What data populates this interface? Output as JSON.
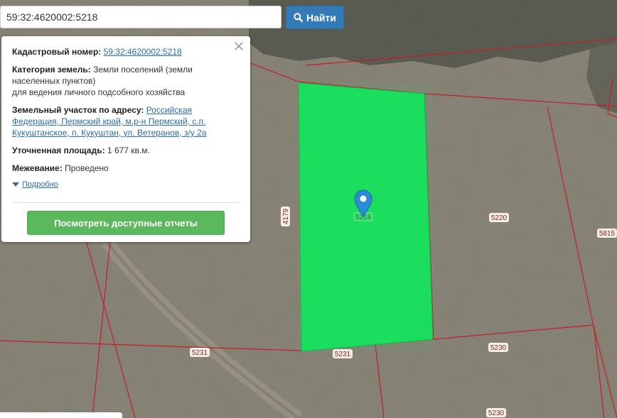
{
  "search": {
    "value": "59:32:4620002:5218",
    "button_label": "Найти"
  },
  "popup": {
    "cadastral_label": "Кадастровый номер:",
    "cadastral_value": "59:32:4620002:5218",
    "category_label": "Категория земель:",
    "category_value_1": "Земли поселений (земли",
    "category_value_2": "населенных пунктов)",
    "category_value_3": "для ведения личного подсобного хозяйства",
    "address_label": "Земельный участок по адресу:",
    "address_value_1": "Российская",
    "address_value_2": "Федерация, Пермский край, м.р-н Пермский, с.п.",
    "address_value_3": "Кукуштанское, п. Кукуштан, ул. Ветеранов, з/у 2а",
    "area_label": "Уточненная площадь:",
    "area_value": "1 677 кв.м.",
    "survey_label": "Межевание:",
    "survey_value": "Проведено",
    "details_link": "Подробно",
    "reports_button": "Посмотреть доступные отчеты"
  },
  "map": {
    "parcel_labels": {
      "selected": "5218",
      "p4179": "4179",
      "p5220": "5220",
      "p5815": "5815",
      "p5231_left": "5231",
      "p5231_center": "5231",
      "p5230_right": "5230",
      "p5230_bottom": "5230"
    },
    "colors": {
      "parcel_fill": "#18e05a",
      "boundary": "#c0202a",
      "label_text": "#8a1f1f"
    }
  }
}
